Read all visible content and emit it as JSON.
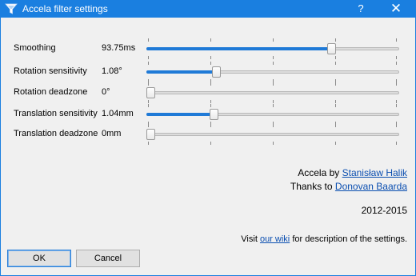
{
  "window": {
    "title": "Accela filter settings",
    "help_symbol": "?",
    "close_symbol": "✕",
    "title_bar_color": "#1a7fe0"
  },
  "settings": [
    {
      "label": "Smoothing",
      "value": "93.75ms",
      "slider_fraction": 0.74
    },
    {
      "label": "Rotation sensitivity",
      "value": "1.08°",
      "slider_fraction": 0.27
    },
    {
      "label": "Rotation deadzone",
      "value": "0°",
      "slider_fraction": 0.0
    },
    {
      "label": "Translation sensitivity",
      "value": "1.04mm",
      "slider_fraction": 0.26
    },
    {
      "label": "Translation deadzone",
      "value": "0mm",
      "slider_fraction": 0.0
    }
  ],
  "credits": {
    "author_prefix": "Accela by",
    "author_name": "Stanisław Halik",
    "thanks_prefix": "Thanks to",
    "thanks_name": "Donovan Baarda",
    "years": "2012-2015"
  },
  "footer": {
    "visit_prefix": "Visit",
    "wiki_link": "our wiki",
    "visit_suffix": "for description of the settings."
  },
  "buttons": {
    "ok": "OK",
    "cancel": "Cancel"
  },
  "colors": {
    "accent": "#1f7ad7",
    "link": "#0a4eb0"
  }
}
